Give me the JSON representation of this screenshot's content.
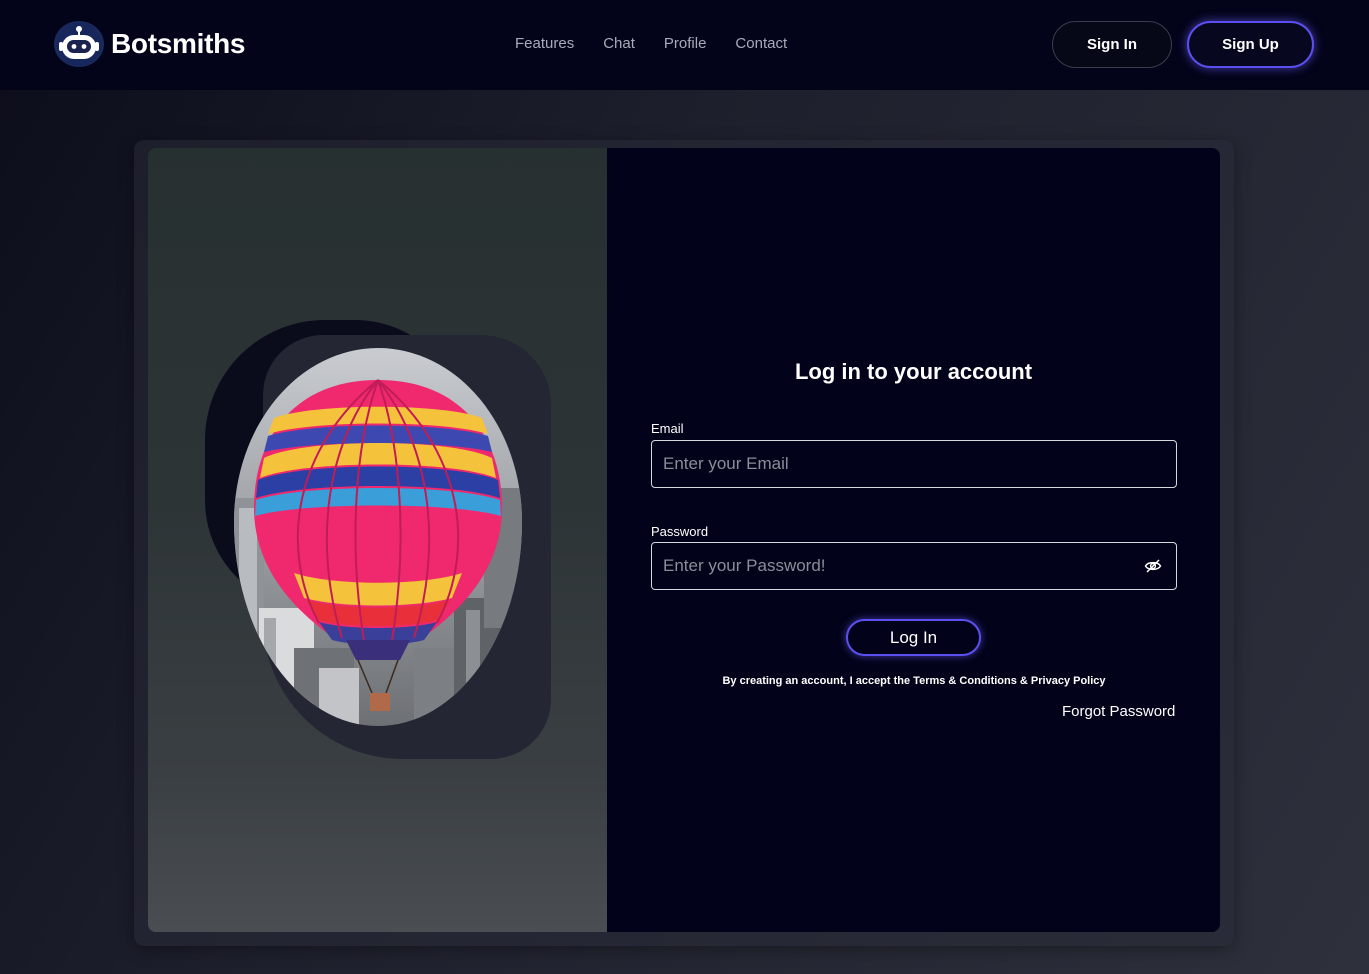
{
  "header": {
    "brand": "Botsmiths",
    "nav": [
      "Features",
      "Chat",
      "Profile",
      "Contact"
    ],
    "sign_in": "Sign In",
    "sign_up": "Sign Up"
  },
  "login": {
    "title": "Log in to your account",
    "email_label": "Email",
    "email_placeholder": "Enter your Email",
    "password_label": "Password",
    "password_placeholder": "Enter your Password!",
    "login_button": "Log In",
    "terms": "By creating an account, I accept the Terms & Conditions & Privacy Policy",
    "forgot": "Forgot Password"
  },
  "icons": {
    "logo": "robot-icon",
    "password_toggle": "eye-slash-icon",
    "illustration": "hot-air-balloon-image"
  },
  "colors": {
    "accent": "#5b4ff0",
    "header_bg": "#03041a",
    "panel_bg": "#02031a"
  }
}
